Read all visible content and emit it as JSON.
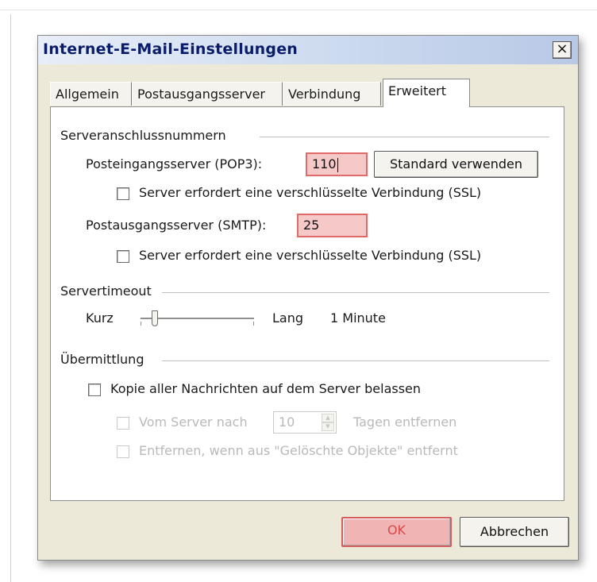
{
  "dialog": {
    "title": "Internet-E-Mail-Einstellungen",
    "close_glyph": "×"
  },
  "tabs": [
    {
      "label": "Allgemein"
    },
    {
      "label": "Postausgangsserver"
    },
    {
      "label": "Verbindung"
    },
    {
      "label": "Erweitert",
      "active": true
    }
  ],
  "server_ports": {
    "group_label": "Serveranschlussnummern",
    "incoming_label": "Posteingangsserver (POP3):",
    "incoming_value": "110",
    "default_button": "Standard verwenden",
    "ssl_incoming_label": "Server erfordert eine verschlüsselte Verbindung (SSL)",
    "outgoing_label": "Postausgangsserver (SMTP):",
    "outgoing_value": "25",
    "ssl_outgoing_label": "Server erfordert eine verschlüsselte Verbindung (SSL)"
  },
  "timeout": {
    "group_label": "Servertimeout",
    "short_label": "Kurz",
    "long_label": "Lang",
    "value_label": "1 Minute",
    "slider_level": 0.1
  },
  "delivery": {
    "group_label": "Übermittlung",
    "leave_copy_label": "Kopie aller Nachrichten auf dem Server belassen",
    "remove_after_prefix": "Vom Server nach",
    "remove_after_days": "10",
    "remove_after_suffix": "Tagen entfernen",
    "remove_deleted_label": "Entfernen, wenn aus \"Gelöschte Objekte\" entfernt"
  },
  "footer": {
    "ok_label": "OK",
    "cancel_label": "Abbrechen"
  },
  "colors": {
    "highlight_fill": "#f6c9c9",
    "highlight_border": "#e06a6a",
    "dialog_bg": "#ece9d8"
  }
}
